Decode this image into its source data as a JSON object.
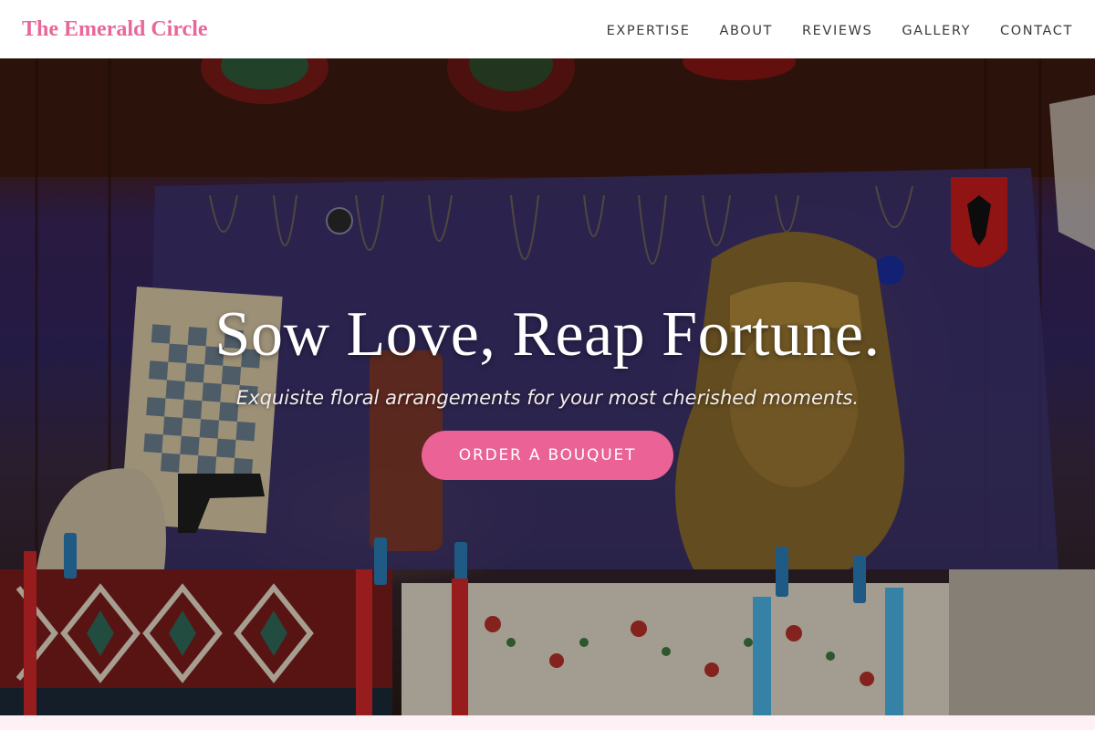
{
  "brand": {
    "name": "The Emerald Circle"
  },
  "nav": {
    "items": [
      {
        "label": "EXPERTISE"
      },
      {
        "label": "ABOUT"
      },
      {
        "label": "REVIEWS"
      },
      {
        "label": "GALLERY"
      },
      {
        "label": "CONTACT"
      }
    ]
  },
  "hero": {
    "title": "Sow Love, Reap Fortune.",
    "subtitle": "Exquisite floral arrangements for your most cherished moments.",
    "cta_label": "ORDER A BOUQUET"
  },
  "colors": {
    "brand": "#e8679a",
    "cta": "#ea6296",
    "nav_text": "#3a3a3a",
    "strip": "#fdf1f5"
  }
}
